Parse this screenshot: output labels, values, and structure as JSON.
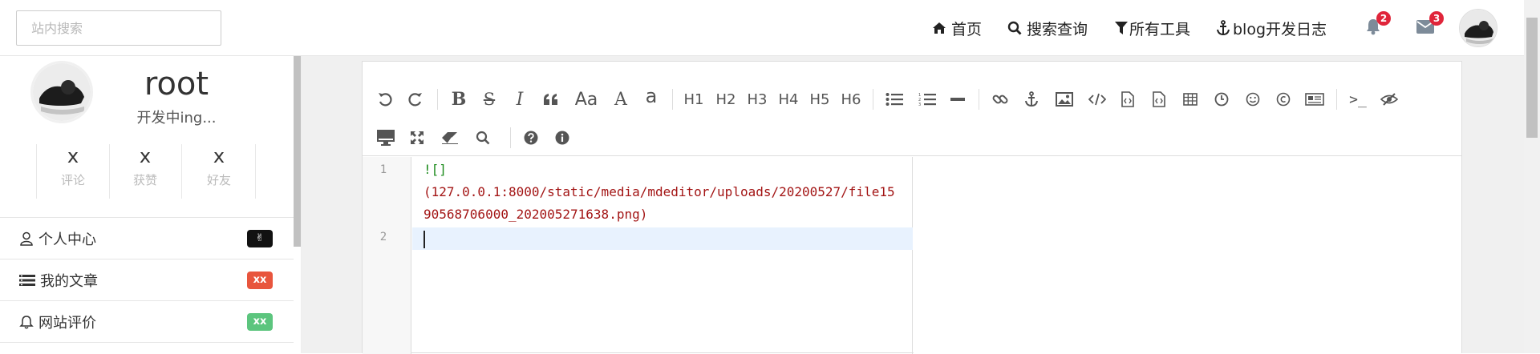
{
  "header": {
    "search_placeholder": "站内搜索",
    "nav": [
      {
        "label": "首页",
        "icon": "home-icon"
      },
      {
        "label": "搜索查询",
        "icon": "search-icon"
      },
      {
        "label": "所有工具",
        "icon": "filter-icon"
      },
      {
        "label": "blog开发日志",
        "icon": "anchor-icon"
      }
    ],
    "notifications": {
      "count": "2",
      "icon": "bell-icon"
    },
    "messages": {
      "count": "3",
      "icon": "envelope-icon"
    }
  },
  "profile": {
    "name": "root",
    "subtitle": "开发中ing...",
    "stats": [
      {
        "value": "x",
        "label": "评论"
      },
      {
        "value": "x",
        "label": "获赞"
      },
      {
        "value": "x",
        "label": "好友"
      }
    ]
  },
  "menu": [
    {
      "label": "个人中心",
      "badge": "✌",
      "badge_color": "#111111",
      "icon": "user-icon"
    },
    {
      "label": "我的文章",
      "badge": "xx",
      "badge_color": "#e8553d",
      "icon": "list-icon"
    },
    {
      "label": "网站评价",
      "badge": "xx",
      "badge_color": "#5cc57e",
      "icon": "bell-outline-icon"
    }
  ],
  "editor": {
    "toolbar_text": {
      "aa": "Aa",
      "a_big": "A",
      "a_small": "a",
      "h1": "H1",
      "h2": "H2",
      "h3": "H3",
      "h4": "H4",
      "h5": "H5",
      "h6": "H6",
      "terminal": ">_"
    },
    "line_numbers": [
      "1",
      "2"
    ],
    "lines": {
      "l1a": "![]",
      "l1b": "(127.0.0.1:8000/static/media/mdeditor/uploads/20200527/file15",
      "l1c": "90568706000_202005271638.png)"
    }
  },
  "colors": {
    "badge_red": "#e0253a",
    "md_green": "#1a8a1a",
    "md_url_red": "#a31515"
  }
}
